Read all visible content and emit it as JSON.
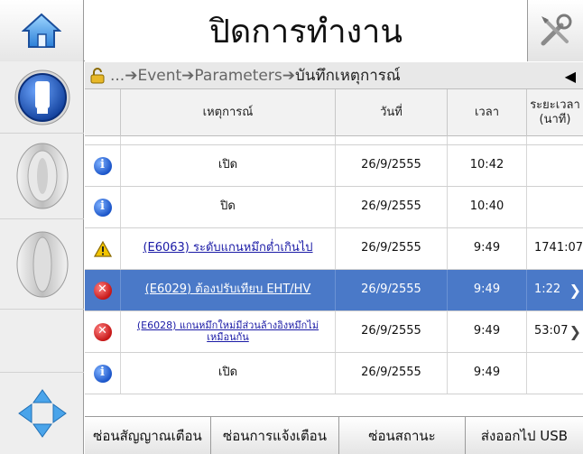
{
  "header": {
    "title": "ปิดการทำงาน",
    "home_icon": "home-icon",
    "tools_icon": "tools-icon"
  },
  "left_rail": {
    "items": [
      "printer-icon",
      "knob-icon",
      "knob-icon",
      "navigation-arrows-icon"
    ]
  },
  "breadcrumb": {
    "prefix": "... ",
    "path": [
      "Event",
      "Parameters"
    ],
    "current": "บันทึกเหตุการณ์",
    "separator": "➔",
    "lock_icon": "lock-icon",
    "back_icon": "back-arrow-icon"
  },
  "table": {
    "columns": [
      "เหตุการณ์",
      "วันที่",
      "เวลา",
      "ระยะเวลา\n(นาที)"
    ],
    "rows": [
      {
        "icon": "info",
        "event": "เปิด",
        "date": "26/9/2555",
        "time": "10:42",
        "duration": "",
        "link": false,
        "selected": false,
        "chevron": false
      },
      {
        "icon": "info",
        "event": "ปิด",
        "date": "26/9/2555",
        "time": "10:40",
        "duration": "",
        "link": false,
        "selected": false,
        "chevron": false
      },
      {
        "icon": "warning",
        "event": "(E6063) ระดับแกนหมึกต่ำเกินไป",
        "date": "26/9/2555",
        "time": "9:49",
        "duration": "1741:07",
        "link": true,
        "selected": false,
        "chevron": false
      },
      {
        "icon": "error",
        "event": "(E6029) ต้องปรับเทียบ EHT/HV",
        "date": "26/9/2555",
        "time": "9:49",
        "duration": "1:22",
        "link": true,
        "selected": true,
        "chevron": true
      },
      {
        "icon": "error",
        "event": "(E6028) แกนหมึกใหม่มีส่วนล้างอิงหมึกไม่เหมือนกัน",
        "date": "26/9/2555",
        "time": "9:49",
        "duration": "53:07",
        "link": true,
        "selected": false,
        "chevron": true
      },
      {
        "icon": "info",
        "event": "เปิด",
        "date": "26/9/2555",
        "time": "9:49",
        "duration": "",
        "link": false,
        "selected": false,
        "chevron": false
      }
    ]
  },
  "footer": {
    "buttons": [
      "ซ่อนสัญญาณเตือน",
      "ซ่อนการแจ้งเตือน",
      "ซ่อนสถานะ",
      "ส่งออกไป USB"
    ]
  }
}
